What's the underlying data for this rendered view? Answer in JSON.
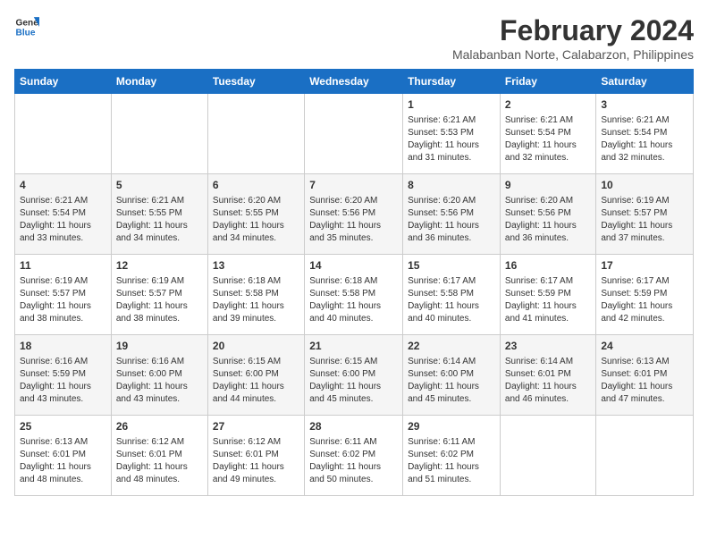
{
  "header": {
    "logo_line1": "General",
    "logo_line2": "Blue",
    "month": "February 2024",
    "location": "Malabanban Norte, Calabarzon, Philippines"
  },
  "days_of_week": [
    "Sunday",
    "Monday",
    "Tuesday",
    "Wednesday",
    "Thursday",
    "Friday",
    "Saturday"
  ],
  "weeks": [
    [
      {
        "num": "",
        "info": ""
      },
      {
        "num": "",
        "info": ""
      },
      {
        "num": "",
        "info": ""
      },
      {
        "num": "",
        "info": ""
      },
      {
        "num": "1",
        "info": "Sunrise: 6:21 AM\nSunset: 5:53 PM\nDaylight: 11 hours\nand 31 minutes."
      },
      {
        "num": "2",
        "info": "Sunrise: 6:21 AM\nSunset: 5:54 PM\nDaylight: 11 hours\nand 32 minutes."
      },
      {
        "num": "3",
        "info": "Sunrise: 6:21 AM\nSunset: 5:54 PM\nDaylight: 11 hours\nand 32 minutes."
      }
    ],
    [
      {
        "num": "4",
        "info": "Sunrise: 6:21 AM\nSunset: 5:54 PM\nDaylight: 11 hours\nand 33 minutes."
      },
      {
        "num": "5",
        "info": "Sunrise: 6:21 AM\nSunset: 5:55 PM\nDaylight: 11 hours\nand 34 minutes."
      },
      {
        "num": "6",
        "info": "Sunrise: 6:20 AM\nSunset: 5:55 PM\nDaylight: 11 hours\nand 34 minutes."
      },
      {
        "num": "7",
        "info": "Sunrise: 6:20 AM\nSunset: 5:56 PM\nDaylight: 11 hours\nand 35 minutes."
      },
      {
        "num": "8",
        "info": "Sunrise: 6:20 AM\nSunset: 5:56 PM\nDaylight: 11 hours\nand 36 minutes."
      },
      {
        "num": "9",
        "info": "Sunrise: 6:20 AM\nSunset: 5:56 PM\nDaylight: 11 hours\nand 36 minutes."
      },
      {
        "num": "10",
        "info": "Sunrise: 6:19 AM\nSunset: 5:57 PM\nDaylight: 11 hours\nand 37 minutes."
      }
    ],
    [
      {
        "num": "11",
        "info": "Sunrise: 6:19 AM\nSunset: 5:57 PM\nDaylight: 11 hours\nand 38 minutes."
      },
      {
        "num": "12",
        "info": "Sunrise: 6:19 AM\nSunset: 5:57 PM\nDaylight: 11 hours\nand 38 minutes."
      },
      {
        "num": "13",
        "info": "Sunrise: 6:18 AM\nSunset: 5:58 PM\nDaylight: 11 hours\nand 39 minutes."
      },
      {
        "num": "14",
        "info": "Sunrise: 6:18 AM\nSunset: 5:58 PM\nDaylight: 11 hours\nand 40 minutes."
      },
      {
        "num": "15",
        "info": "Sunrise: 6:17 AM\nSunset: 5:58 PM\nDaylight: 11 hours\nand 40 minutes."
      },
      {
        "num": "16",
        "info": "Sunrise: 6:17 AM\nSunset: 5:59 PM\nDaylight: 11 hours\nand 41 minutes."
      },
      {
        "num": "17",
        "info": "Sunrise: 6:17 AM\nSunset: 5:59 PM\nDaylight: 11 hours\nand 42 minutes."
      }
    ],
    [
      {
        "num": "18",
        "info": "Sunrise: 6:16 AM\nSunset: 5:59 PM\nDaylight: 11 hours\nand 43 minutes."
      },
      {
        "num": "19",
        "info": "Sunrise: 6:16 AM\nSunset: 6:00 PM\nDaylight: 11 hours\nand 43 minutes."
      },
      {
        "num": "20",
        "info": "Sunrise: 6:15 AM\nSunset: 6:00 PM\nDaylight: 11 hours\nand 44 minutes."
      },
      {
        "num": "21",
        "info": "Sunrise: 6:15 AM\nSunset: 6:00 PM\nDaylight: 11 hours\nand 45 minutes."
      },
      {
        "num": "22",
        "info": "Sunrise: 6:14 AM\nSunset: 6:00 PM\nDaylight: 11 hours\nand 45 minutes."
      },
      {
        "num": "23",
        "info": "Sunrise: 6:14 AM\nSunset: 6:01 PM\nDaylight: 11 hours\nand 46 minutes."
      },
      {
        "num": "24",
        "info": "Sunrise: 6:13 AM\nSunset: 6:01 PM\nDaylight: 11 hours\nand 47 minutes."
      }
    ],
    [
      {
        "num": "25",
        "info": "Sunrise: 6:13 AM\nSunset: 6:01 PM\nDaylight: 11 hours\nand 48 minutes."
      },
      {
        "num": "26",
        "info": "Sunrise: 6:12 AM\nSunset: 6:01 PM\nDaylight: 11 hours\nand 48 minutes."
      },
      {
        "num": "27",
        "info": "Sunrise: 6:12 AM\nSunset: 6:01 PM\nDaylight: 11 hours\nand 49 minutes."
      },
      {
        "num": "28",
        "info": "Sunrise: 6:11 AM\nSunset: 6:02 PM\nDaylight: 11 hours\nand 50 minutes."
      },
      {
        "num": "29",
        "info": "Sunrise: 6:11 AM\nSunset: 6:02 PM\nDaylight: 11 hours\nand 51 minutes."
      },
      {
        "num": "",
        "info": ""
      },
      {
        "num": "",
        "info": ""
      }
    ]
  ]
}
